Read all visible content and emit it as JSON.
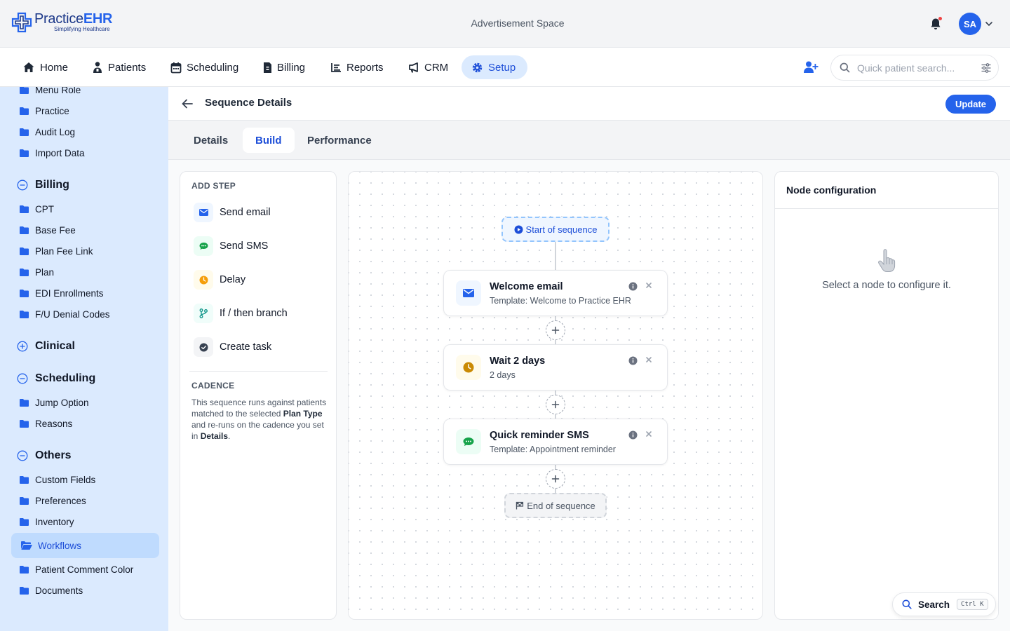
{
  "header": {
    "brand_name_a": "Practice",
    "brand_name_b": "EHR",
    "brand_tagline": "Simplifying Healthcare",
    "ad_space": "Advertisement Space",
    "user_initials": "SA"
  },
  "nav": {
    "items": [
      {
        "label": "Home",
        "icon": "home-icon"
      },
      {
        "label": "Patients",
        "icon": "patient-icon"
      },
      {
        "label": "Scheduling",
        "icon": "calendar-icon"
      },
      {
        "label": "Billing",
        "icon": "invoice-icon"
      },
      {
        "label": "Reports",
        "icon": "report-icon"
      },
      {
        "label": "CRM",
        "icon": "megaphone-icon"
      },
      {
        "label": "Setup",
        "icon": "gear-icon",
        "active": true
      }
    ],
    "search_placeholder": "Quick patient search..."
  },
  "sidebar": {
    "top_items": [
      "Menu Role",
      "Practice",
      "Audit Log",
      "Import Data"
    ],
    "groups": [
      {
        "label": "Billing",
        "expanded": true,
        "items": [
          "CPT",
          "Base Fee",
          "Plan Fee Link",
          "Plan",
          "EDI Enrollments",
          "F/U Denial Codes"
        ]
      },
      {
        "label": "Clinical",
        "expanded": false,
        "items": []
      },
      {
        "label": "Scheduling",
        "expanded": true,
        "items": [
          "Jump Option",
          "Reasons"
        ]
      },
      {
        "label": "Others",
        "expanded": true,
        "items": [
          "Custom Fields",
          "Preferences",
          "Inventory",
          "Workflows",
          "Patient Comment Color",
          "Documents"
        ]
      }
    ],
    "active_item": "Workflows"
  },
  "page": {
    "title": "Sequence Details",
    "update_label": "Update",
    "tabs": [
      "Details",
      "Build",
      "Performance"
    ],
    "active_tab": "Build"
  },
  "add_step": {
    "heading": "ADD STEP",
    "steps": [
      {
        "label": "Send email",
        "icon": "envelope-icon",
        "color": "#2563eb"
      },
      {
        "label": "Send SMS",
        "icon": "chat-icon",
        "color": "#16a34a"
      },
      {
        "label": "Delay",
        "icon": "clock-icon",
        "color": "#f59e0b"
      },
      {
        "label": "If / then branch",
        "icon": "branch-icon",
        "color": "#0d9488"
      },
      {
        "label": "Create task",
        "icon": "check-circle-icon",
        "color": "#374151"
      }
    ],
    "cadence_heading": "CADENCE",
    "cadence_text_1": "This sequence runs against patients matched to the selected ",
    "cadence_bold_1": "Plan Type",
    "cadence_text_2": " and re-runs on the cadence you set in ",
    "cadence_bold_2": "Details",
    "cadence_text_3": "."
  },
  "canvas": {
    "start_label": "Start of sequence",
    "end_label": "End of sequence",
    "nodes": [
      {
        "title": "Welcome email",
        "subtitle": "Template: Welcome to Practice EHR",
        "icon": "envelope-icon"
      },
      {
        "title": "Wait 2 days",
        "subtitle": "2 days",
        "icon": "clock-icon"
      },
      {
        "title": "Quick reminder SMS",
        "subtitle": "Template: Appointment reminder",
        "icon": "chat-icon"
      }
    ]
  },
  "config": {
    "title": "Node configuration",
    "empty_text": "Select a node to configure it."
  },
  "floating_search": {
    "label": "Search",
    "shortcut": "Ctrl K"
  }
}
